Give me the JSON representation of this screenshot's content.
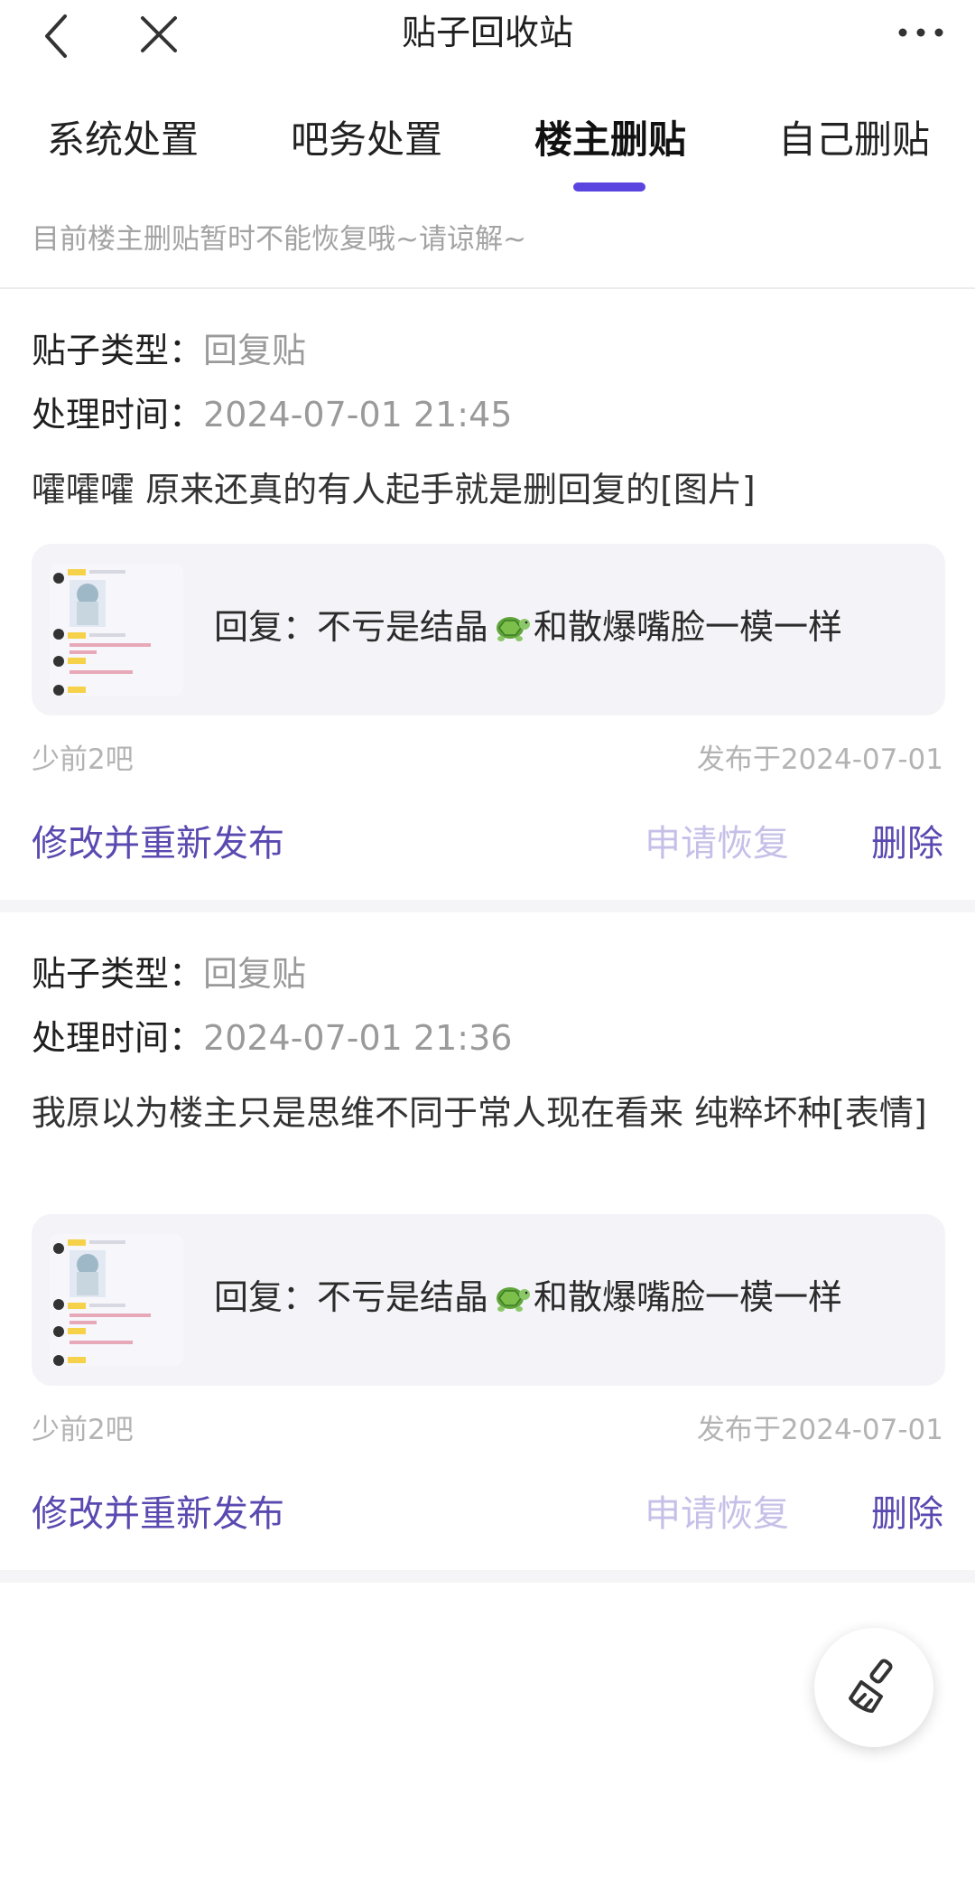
{
  "header": {
    "title": "贴子回收站"
  },
  "tabs": [
    {
      "label": "系统处置",
      "active": false
    },
    {
      "label": "吧务处置",
      "active": false
    },
    {
      "label": "楼主删贴",
      "active": true
    },
    {
      "label": "自己删贴",
      "active": false
    }
  ],
  "notice": "目前楼主删贴暂时不能恢复哦~请谅解~",
  "colors": {
    "accent": "#5b45e0",
    "action": "#5a49b0",
    "action_disabled": "#c6c0e8"
  },
  "posts": [
    {
      "type_key": "贴子类型：",
      "type_value": "回复贴",
      "time_key": "处理时间：",
      "time_value": "2024-07-01 21:45",
      "content": "嚯嚯嚯 原来还真的有人起手就是删回复的[图片]",
      "quote_prefix": "回复：不亏是结晶",
      "quote_suffix": "和散爆嘴脸一模一样",
      "forum": "少前2吧",
      "published": "发布于2024-07-01",
      "edit_label": "修改并重新发布",
      "restore_label": "申请恢复",
      "delete_label": "删除"
    },
    {
      "type_key": "贴子类型：",
      "type_value": "回复贴",
      "time_key": "处理时间：",
      "time_value": "2024-07-01 21:36",
      "content": "我原以为楼主只是思维不同于常人现在看来 纯粹坏种[表情]",
      "quote_prefix": "回复：不亏是结晶",
      "quote_suffix": "和散爆嘴脸一模一样",
      "forum": "少前2吧",
      "published": "发布于2024-07-01",
      "edit_label": "修改并重新发布",
      "restore_label": "申请恢复",
      "delete_label": "删除"
    }
  ],
  "icons": {
    "back": "chevron-left-icon",
    "close": "close-icon",
    "more": "more-dots-icon",
    "turtle": "turtle-emoji-icon",
    "fab": "broom-icon"
  }
}
